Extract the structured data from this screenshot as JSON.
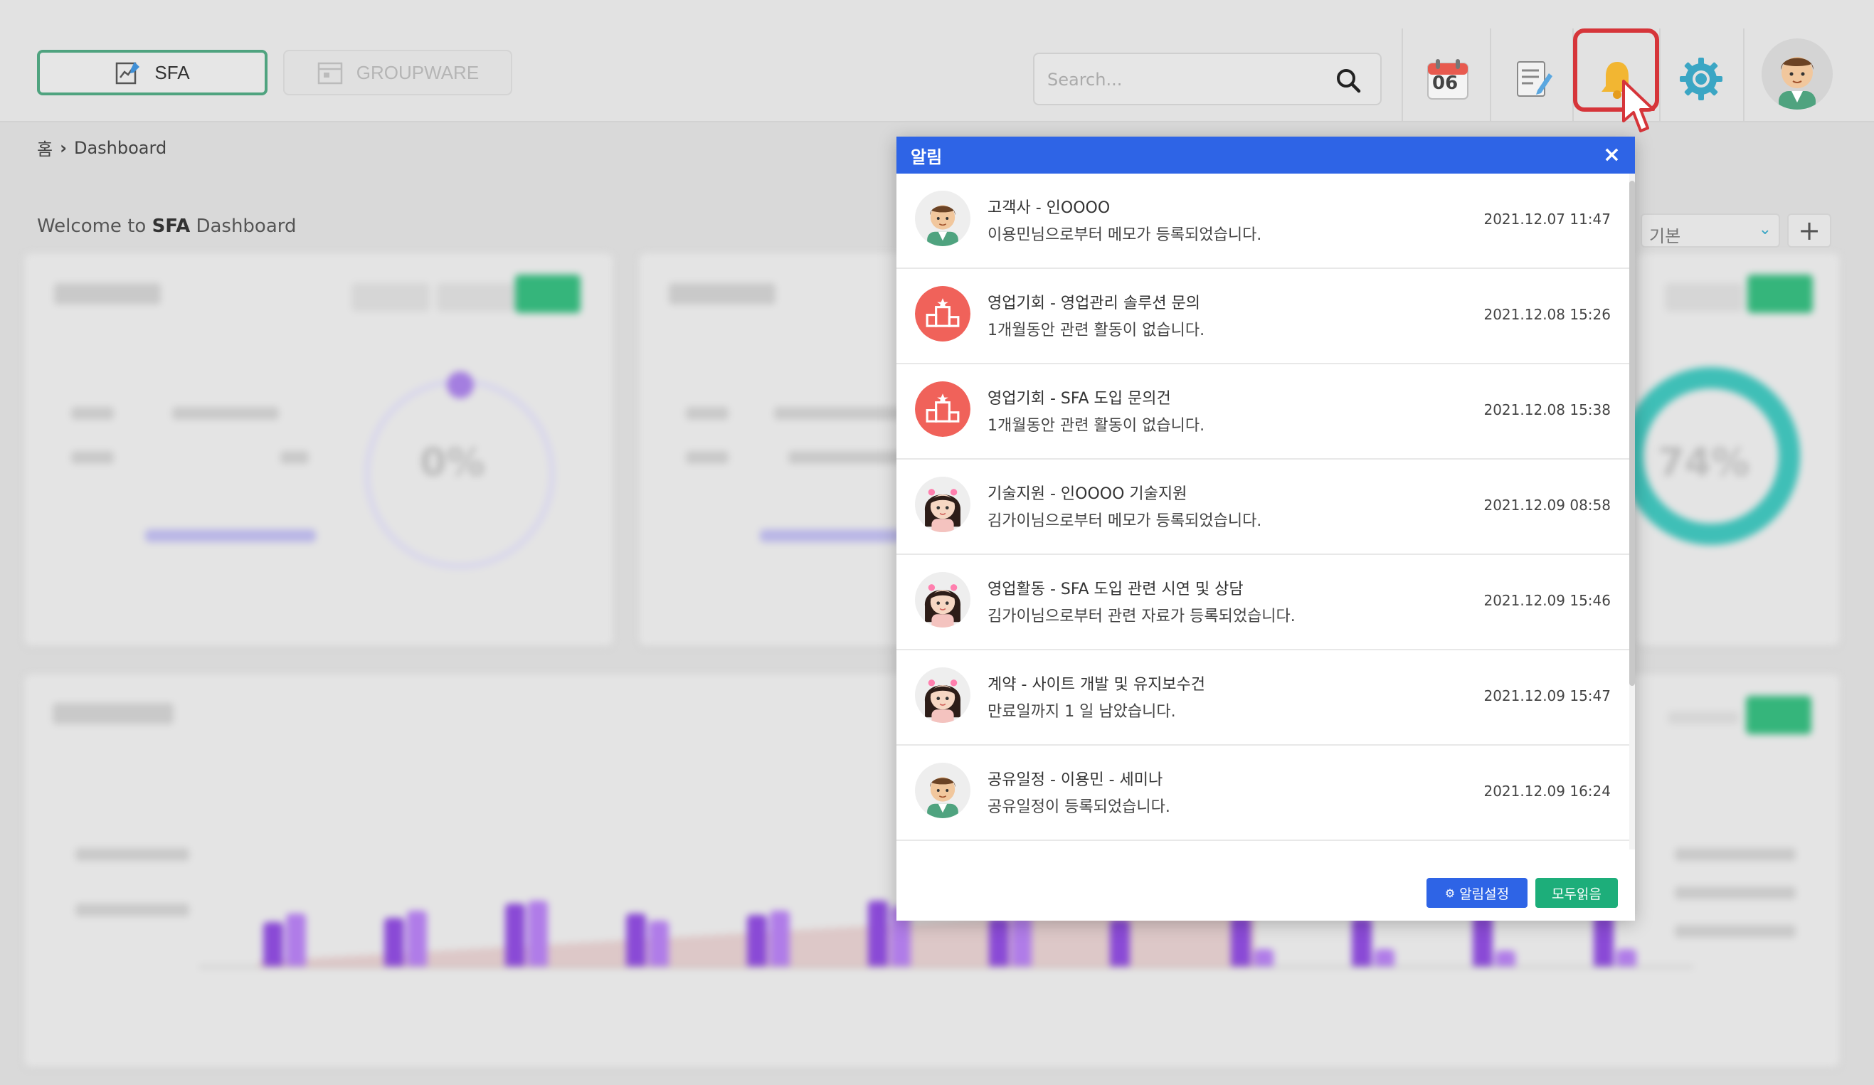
{
  "header": {
    "tabs": [
      {
        "label": "SFA",
        "icon": "chart-edit-icon",
        "active": true
      },
      {
        "label": "GROUPWARE",
        "icon": "calendar-grid-icon",
        "active": false
      }
    ],
    "search_placeholder": "Search...",
    "calendar_day": "06",
    "icons": [
      "calendar-icon",
      "memo-icon",
      "bell-icon",
      "gear-icon",
      "avatar"
    ]
  },
  "breadcrumb": {
    "home": "홈",
    "separator": "›",
    "current": "Dashboard"
  },
  "welcome": {
    "prefix": "Welcome to ",
    "brand": "SFA",
    "suffix": " Dashboard"
  },
  "dashboard": {
    "select_value": "기본",
    "add_label": "+",
    "donut_left": "0%",
    "donut_right": "74%"
  },
  "notifications": {
    "title": "알림",
    "close_label": "×",
    "items": [
      {
        "avatar": "man",
        "title": "고객사 - 인OOOO",
        "message": "이용민님으로부터 메모가 등록되었습니다.",
        "time": "2021.12.07 11:47"
      },
      {
        "avatar": "podium",
        "title": "영업기회 - 영업관리 솔루션 문의",
        "message": "1개월동안 관련 활동이 없습니다.",
        "time": "2021.12.08 15:26"
      },
      {
        "avatar": "podium",
        "title": "영업기회 - SFA 도입 문의건",
        "message": "1개월동안 관련 활동이 없습니다.",
        "time": "2021.12.08 15:38"
      },
      {
        "avatar": "woman",
        "title": "기술지원 - 인OOOO 기술지원",
        "message": "김가이님으로부터 메모가 등록되었습니다.",
        "time": "2021.12.09 08:58"
      },
      {
        "avatar": "woman",
        "title": "영업활동 - SFA 도입 관련 시연 및 상담",
        "message": "김가이님으로부터 관련 자료가 등록되었습니다.",
        "time": "2021.12.09 15:46"
      },
      {
        "avatar": "woman",
        "title": "계약 - 사이트 개발 및 유지보수건",
        "message": "만료일까지 1 일 남았습니다.",
        "time": "2021.12.09 15:47"
      },
      {
        "avatar": "man",
        "title": "공유일정 - 이용민 - 세미나",
        "message": "공유일정이 등록되었습니다.",
        "time": "2021.12.09 16:24"
      }
    ],
    "settings_label": "알림설정",
    "read_all_label": "모두읽음"
  },
  "colors": {
    "popup_header": "#2e64e6",
    "settings_button": "#2e64e6",
    "read_all_button": "#1dae7a",
    "bell_highlight": "#d6353a",
    "podium_avatar": "#f0625a",
    "sfa_tab_border": "#4fa37f"
  }
}
